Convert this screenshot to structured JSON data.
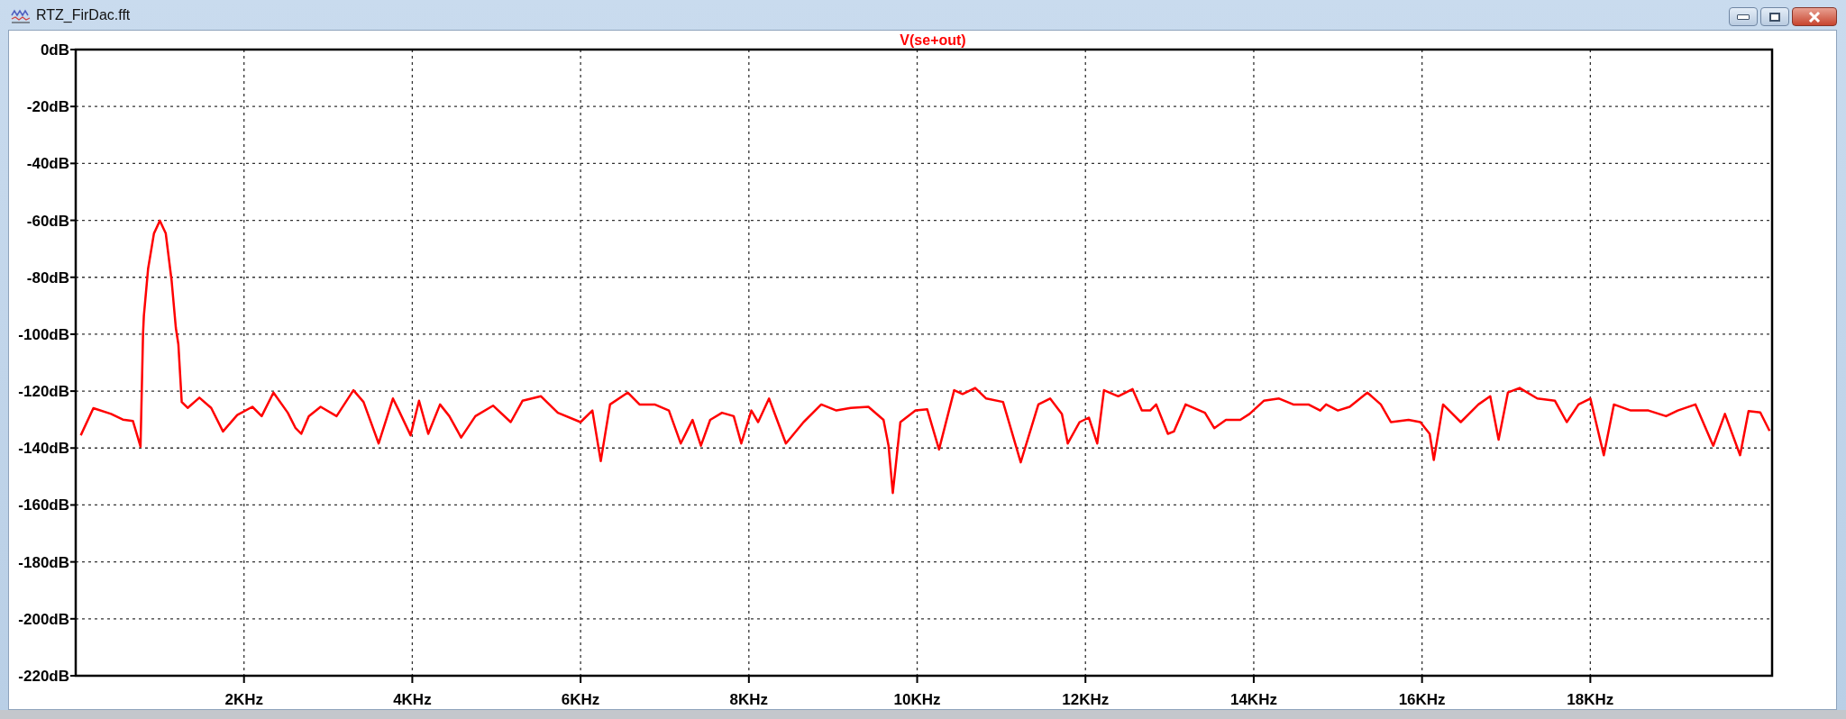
{
  "window": {
    "title": "RTZ_FirDac.fft"
  },
  "plot": {
    "chart_data": {
      "type": "line",
      "grid": true,
      "xlim": [
        0,
        20.16
      ],
      "ylim": [
        -220,
        0
      ],
      "xticks": [
        {
          "value": 2,
          "label": "2KHz"
        },
        {
          "value": 4,
          "label": "4KHz"
        },
        {
          "value": 6,
          "label": "6KHz"
        },
        {
          "value": 8,
          "label": "8KHz"
        },
        {
          "value": 10,
          "label": "10KHz"
        },
        {
          "value": 12,
          "label": "12KHz"
        },
        {
          "value": 14,
          "label": "14KHz"
        },
        {
          "value": 16,
          "label": "16KHz"
        },
        {
          "value": 18,
          "label": "18KHz"
        }
      ],
      "yticks": [
        {
          "value": 0,
          "label": "0dB"
        },
        {
          "value": -20,
          "label": "-20dB"
        },
        {
          "value": -40,
          "label": "-40dB"
        },
        {
          "value": -60,
          "label": "-60dB"
        },
        {
          "value": -80,
          "label": "-80dB"
        },
        {
          "value": -100,
          "label": "-100dB"
        },
        {
          "value": -120,
          "label": "-120dB"
        },
        {
          "value": -140,
          "label": "-140dB"
        },
        {
          "value": -160,
          "label": "-160dB"
        },
        {
          "value": -180,
          "label": "-180dB"
        },
        {
          "value": -200,
          "label": "-200dB"
        },
        {
          "value": -220,
          "label": "-220dB"
        }
      ],
      "x": [
        0.06,
        0.21,
        0.42,
        0.56,
        0.68,
        0.77,
        0.8,
        0.81,
        0.86,
        0.93,
        1.0,
        1.07,
        1.14,
        1.19,
        1.22,
        1.26,
        1.33,
        1.47,
        1.61,
        1.75,
        1.92,
        2.1,
        2.21,
        2.35,
        2.52,
        2.61,
        2.68,
        2.77,
        2.91,
        3.1,
        3.3,
        3.42,
        3.6,
        3.77,
        3.84,
        3.98,
        4.08,
        4.19,
        4.33,
        4.44,
        4.58,
        4.75,
        4.96,
        5.17,
        5.31,
        5.53,
        5.73,
        6.0,
        6.14,
        6.24,
        6.35,
        6.56,
        6.7,
        6.88,
        7.05,
        7.19,
        7.33,
        7.43,
        7.54,
        7.68,
        7.82,
        7.91,
        8.03,
        8.11,
        8.24,
        8.44,
        8.65,
        8.86,
        9.04,
        9.21,
        9.42,
        9.6,
        9.66,
        9.71,
        9.8,
        9.98,
        10.12,
        10.26,
        10.44,
        10.54,
        10.69,
        10.82,
        11.02,
        11.23,
        11.44,
        11.58,
        11.72,
        11.79,
        11.93,
        12.04,
        12.14,
        12.22,
        12.39,
        12.56,
        12.67,
        12.77,
        12.84,
        12.98,
        13.05,
        13.19,
        13.42,
        13.53,
        13.67,
        13.84,
        13.95,
        14.12,
        14.3,
        14.47,
        14.65,
        14.79,
        14.86,
        15.0,
        15.14,
        15.35,
        15.51,
        15.63,
        15.84,
        15.98,
        16.09,
        16.14,
        16.25,
        16.46,
        16.67,
        16.81,
        16.91,
        17.02,
        17.16,
        17.37,
        17.58,
        17.72,
        17.86,
        18.0,
        18.16,
        18.28,
        18.48,
        18.69,
        18.9,
        19.04,
        19.25,
        19.46,
        19.6,
        19.78,
        19.88,
        20.02,
        20.13
      ],
      "series": [
        {
          "name": "V(se+out)",
          "color": "#ff0000",
          "values": [
            -135.5,
            -126,
            -128,
            -130,
            -130.5,
            -139.5,
            -99.8,
            -93.6,
            -77,
            -64.6,
            -60.1,
            -64.6,
            -81.2,
            -97.8,
            -103.6,
            -123.8,
            -125.9,
            -122.3,
            -125.9,
            -134.2,
            -128.4,
            -125.5,
            -128.8,
            -120.5,
            -127.6,
            -132.9,
            -135.0,
            -128.8,
            -125.5,
            -128.8,
            -119.7,
            -123.8,
            -138.4,
            -122.6,
            -126.8,
            -135.5,
            -123.4,
            -135.0,
            -124.7,
            -128.8,
            -136.3,
            -128.8,
            -125.1,
            -130.9,
            -123.4,
            -121.8,
            -127.6,
            -130.9,
            -126.8,
            -144.6,
            -124.7,
            -120.5,
            -124.7,
            -124.7,
            -126.8,
            -138.4,
            -130.1,
            -139.2,
            -130.1,
            -127.6,
            -128.8,
            -138.4,
            -126.8,
            -130.9,
            -122.6,
            -138.4,
            -130.9,
            -124.7,
            -126.8,
            -125.9,
            -125.5,
            -130.1,
            -139.2,
            -155.8,
            -130.9,
            -126.8,
            -126.4,
            -140.5,
            -119.7,
            -121.0,
            -118.9,
            -122.6,
            -123.8,
            -145.0,
            -124.7,
            -122.6,
            -128.0,
            -138.4,
            -130.9,
            -129.3,
            -138.4,
            -119.7,
            -121.8,
            -119.3,
            -126.8,
            -126.8,
            -124.7,
            -135.0,
            -134.2,
            -124.7,
            -127.6,
            -133.0,
            -130.1,
            -130.1,
            -128.0,
            -123.4,
            -122.6,
            -124.7,
            -124.7,
            -126.8,
            -124.7,
            -126.8,
            -125.5,
            -120.5,
            -124.7,
            -130.9,
            -130.1,
            -130.9,
            -135.0,
            -144.2,
            -124.7,
            -130.9,
            -124.7,
            -121.8,
            -137.1,
            -120.5,
            -118.9,
            -122.6,
            -123.4,
            -130.9,
            -124.7,
            -122.6,
            -142.5,
            -124.7,
            -126.8,
            -126.8,
            -128.8,
            -126.8,
            -124.7,
            -139.2,
            -128.0,
            -142.5,
            -127.0,
            -127.5,
            -134.0
          ]
        }
      ]
    }
  }
}
